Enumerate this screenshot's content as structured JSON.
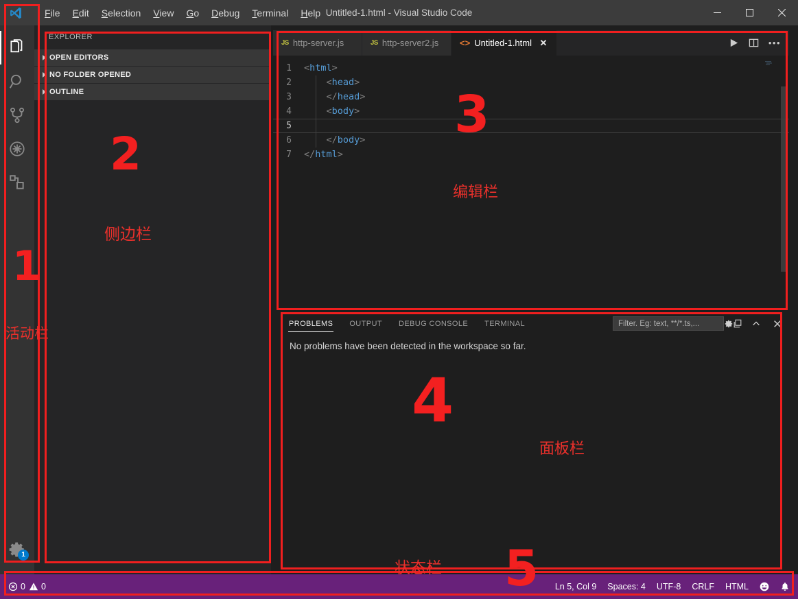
{
  "window": {
    "title": "Untitled-1.html - Visual Studio Code",
    "controls": {
      "minimize": "minimize-icon",
      "maximize": "maximize-icon",
      "close": "close-icon"
    }
  },
  "menubar": {
    "items": [
      {
        "label": "File",
        "accel": "F"
      },
      {
        "label": "Edit",
        "accel": "E"
      },
      {
        "label": "Selection",
        "accel": "S"
      },
      {
        "label": "View",
        "accel": "V"
      },
      {
        "label": "Go",
        "accel": "G"
      },
      {
        "label": "Debug",
        "accel": "D"
      },
      {
        "label": "Terminal",
        "accel": "T"
      },
      {
        "label": "Help",
        "accel": "H"
      }
    ]
  },
  "activitybar": {
    "items": [
      {
        "icon": "files-explorer-icon",
        "title": "Explorer",
        "active": true
      },
      {
        "icon": "search-icon",
        "title": "Search",
        "active": false
      },
      {
        "icon": "source-control-branch-icon",
        "title": "Source Control",
        "active": false
      },
      {
        "icon": "run-debug-icon",
        "title": "Run and Debug",
        "active": false
      },
      {
        "icon": "extensions-icon",
        "title": "Extensions",
        "active": false
      }
    ],
    "manage": {
      "icon": "gear-icon",
      "badge": "1"
    }
  },
  "sidebar": {
    "title": "EXPLORER",
    "sections": [
      {
        "label": "OPEN EDITORS",
        "expanded": false
      },
      {
        "label": "NO FOLDER OPENED",
        "expanded": false
      },
      {
        "label": "OUTLINE",
        "expanded": false
      }
    ]
  },
  "editor": {
    "tabs": [
      {
        "label": "http-server.js",
        "icon": "js-file-icon",
        "badge": "JS",
        "active": false,
        "closable": false
      },
      {
        "label": "http-server2.js",
        "icon": "js-file-icon",
        "badge": "JS",
        "active": false,
        "closable": false
      },
      {
        "label": "Untitled-1.html",
        "icon": "html-file-icon",
        "badge": "<>",
        "active": true,
        "closable": true,
        "close": "✕"
      }
    ],
    "actions": [
      {
        "icon": "run-play-icon",
        "title": "Run"
      },
      {
        "icon": "split-editor-icon",
        "title": "Split Editor"
      },
      {
        "icon": "more-actions-icon",
        "title": "More Actions",
        "glyph": "•••"
      }
    ],
    "language": "html",
    "code": [
      {
        "n": "1",
        "indent": 0,
        "text": "<html>",
        "cursor": false,
        "guide": false
      },
      {
        "n": "2",
        "indent": 1,
        "text": "<head>",
        "cursor": false,
        "guide": true
      },
      {
        "n": "3",
        "indent": 1,
        "text": "</head>",
        "cursor": false,
        "guide": true
      },
      {
        "n": "4",
        "indent": 1,
        "text": "<body>",
        "cursor": false,
        "guide": true
      },
      {
        "n": "5",
        "indent": 1,
        "text": "",
        "cursor": true,
        "guide": true
      },
      {
        "n": "6",
        "indent": 1,
        "text": "</body>",
        "cursor": false,
        "guide": true
      },
      {
        "n": "7",
        "indent": 0,
        "text": "</html>",
        "cursor": false,
        "guide": false
      }
    ]
  },
  "panel": {
    "tabs": [
      {
        "label": "PROBLEMS",
        "active": true
      },
      {
        "label": "OUTPUT",
        "active": false
      },
      {
        "label": "DEBUG CONSOLE",
        "active": false
      },
      {
        "label": "TERMINAL",
        "active": false
      }
    ],
    "filter": {
      "placeholder": "Filter. Eg: text, **/*.ts,...",
      "value": "",
      "gear": "filter-settings-icon"
    },
    "actions": [
      {
        "icon": "clear-panel-icon",
        "title": "Clear"
      },
      {
        "icon": "maximize-panel-icon",
        "title": "Maximize Panel Size",
        "glyph": "⌃"
      },
      {
        "icon": "close-panel-icon",
        "title": "Close Panel",
        "glyph": "✕"
      }
    ],
    "message": "No problems have been detected in the workspace so far."
  },
  "statusbar": {
    "color": "#68217a",
    "left": [
      {
        "icon": "error-icon",
        "value": "0"
      },
      {
        "icon": "warning-icon",
        "value": "0"
      }
    ],
    "right": [
      {
        "name": "cursor-position",
        "label": "Ln 5, Col 9"
      },
      {
        "name": "indentation",
        "label": "Spaces: 4"
      },
      {
        "name": "encoding",
        "label": "UTF-8"
      },
      {
        "name": "eol",
        "label": "CRLF"
      },
      {
        "name": "language-mode",
        "label": "HTML"
      },
      {
        "name": "feedback-smiley-icon",
        "label": "☺"
      },
      {
        "name": "notifications-bell-icon",
        "label": "🔔"
      }
    ]
  },
  "annotations": {
    "accent": "#f01f1f",
    "items": [
      {
        "number": "1",
        "label": "活动栏",
        "region": "activity-bar"
      },
      {
        "number": "2",
        "label": "侧边栏",
        "region": "sidebar"
      },
      {
        "number": "3",
        "label": "编辑栏",
        "region": "editor"
      },
      {
        "number": "4",
        "label": "面板栏",
        "region": "panel"
      },
      {
        "number": "5",
        "label": "状态栏",
        "region": "status-bar"
      }
    ]
  }
}
